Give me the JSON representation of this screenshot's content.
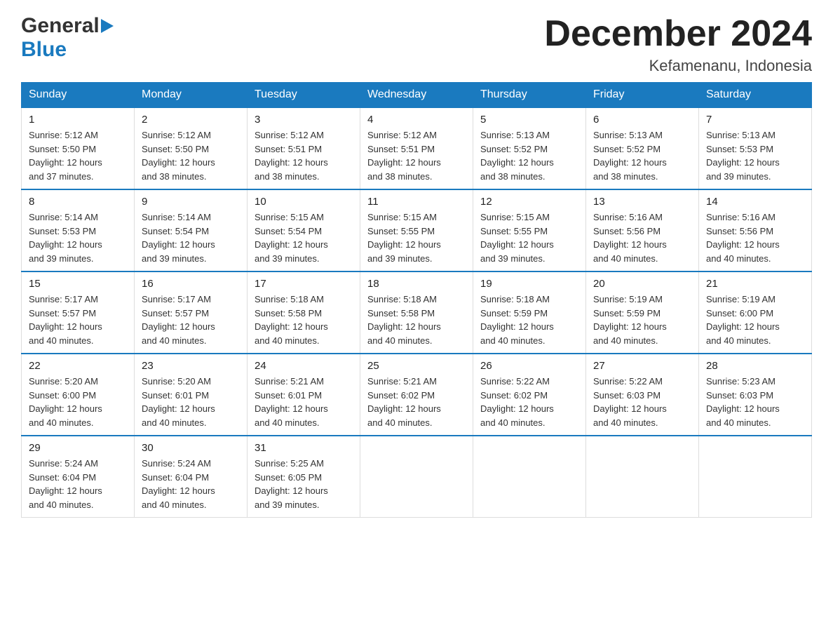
{
  "header": {
    "logo_general": "General",
    "logo_blue": "Blue",
    "month_title": "December 2024",
    "location": "Kefamenanu, Indonesia"
  },
  "days_of_week": [
    "Sunday",
    "Monday",
    "Tuesday",
    "Wednesday",
    "Thursday",
    "Friday",
    "Saturday"
  ],
  "weeks": [
    [
      {
        "day": "1",
        "sunrise": "5:12 AM",
        "sunset": "5:50 PM",
        "daylight": "12 hours and 37 minutes."
      },
      {
        "day": "2",
        "sunrise": "5:12 AM",
        "sunset": "5:50 PM",
        "daylight": "12 hours and 38 minutes."
      },
      {
        "day": "3",
        "sunrise": "5:12 AM",
        "sunset": "5:51 PM",
        "daylight": "12 hours and 38 minutes."
      },
      {
        "day": "4",
        "sunrise": "5:12 AM",
        "sunset": "5:51 PM",
        "daylight": "12 hours and 38 minutes."
      },
      {
        "day": "5",
        "sunrise": "5:13 AM",
        "sunset": "5:52 PM",
        "daylight": "12 hours and 38 minutes."
      },
      {
        "day": "6",
        "sunrise": "5:13 AM",
        "sunset": "5:52 PM",
        "daylight": "12 hours and 38 minutes."
      },
      {
        "day": "7",
        "sunrise": "5:13 AM",
        "sunset": "5:53 PM",
        "daylight": "12 hours and 39 minutes."
      }
    ],
    [
      {
        "day": "8",
        "sunrise": "5:14 AM",
        "sunset": "5:53 PM",
        "daylight": "12 hours and 39 minutes."
      },
      {
        "day": "9",
        "sunrise": "5:14 AM",
        "sunset": "5:54 PM",
        "daylight": "12 hours and 39 minutes."
      },
      {
        "day": "10",
        "sunrise": "5:15 AM",
        "sunset": "5:54 PM",
        "daylight": "12 hours and 39 minutes."
      },
      {
        "day": "11",
        "sunrise": "5:15 AM",
        "sunset": "5:55 PM",
        "daylight": "12 hours and 39 minutes."
      },
      {
        "day": "12",
        "sunrise": "5:15 AM",
        "sunset": "5:55 PM",
        "daylight": "12 hours and 39 minutes."
      },
      {
        "day": "13",
        "sunrise": "5:16 AM",
        "sunset": "5:56 PM",
        "daylight": "12 hours and 40 minutes."
      },
      {
        "day": "14",
        "sunrise": "5:16 AM",
        "sunset": "5:56 PM",
        "daylight": "12 hours and 40 minutes."
      }
    ],
    [
      {
        "day": "15",
        "sunrise": "5:17 AM",
        "sunset": "5:57 PM",
        "daylight": "12 hours and 40 minutes."
      },
      {
        "day": "16",
        "sunrise": "5:17 AM",
        "sunset": "5:57 PM",
        "daylight": "12 hours and 40 minutes."
      },
      {
        "day": "17",
        "sunrise": "5:18 AM",
        "sunset": "5:58 PM",
        "daylight": "12 hours and 40 minutes."
      },
      {
        "day": "18",
        "sunrise": "5:18 AM",
        "sunset": "5:58 PM",
        "daylight": "12 hours and 40 minutes."
      },
      {
        "day": "19",
        "sunrise": "5:18 AM",
        "sunset": "5:59 PM",
        "daylight": "12 hours and 40 minutes."
      },
      {
        "day": "20",
        "sunrise": "5:19 AM",
        "sunset": "5:59 PM",
        "daylight": "12 hours and 40 minutes."
      },
      {
        "day": "21",
        "sunrise": "5:19 AM",
        "sunset": "6:00 PM",
        "daylight": "12 hours and 40 minutes."
      }
    ],
    [
      {
        "day": "22",
        "sunrise": "5:20 AM",
        "sunset": "6:00 PM",
        "daylight": "12 hours and 40 minutes."
      },
      {
        "day": "23",
        "sunrise": "5:20 AM",
        "sunset": "6:01 PM",
        "daylight": "12 hours and 40 minutes."
      },
      {
        "day": "24",
        "sunrise": "5:21 AM",
        "sunset": "6:01 PM",
        "daylight": "12 hours and 40 minutes."
      },
      {
        "day": "25",
        "sunrise": "5:21 AM",
        "sunset": "6:02 PM",
        "daylight": "12 hours and 40 minutes."
      },
      {
        "day": "26",
        "sunrise": "5:22 AM",
        "sunset": "6:02 PM",
        "daylight": "12 hours and 40 minutes."
      },
      {
        "day": "27",
        "sunrise": "5:22 AM",
        "sunset": "6:03 PM",
        "daylight": "12 hours and 40 minutes."
      },
      {
        "day": "28",
        "sunrise": "5:23 AM",
        "sunset": "6:03 PM",
        "daylight": "12 hours and 40 minutes."
      }
    ],
    [
      {
        "day": "29",
        "sunrise": "5:24 AM",
        "sunset": "6:04 PM",
        "daylight": "12 hours and 40 minutes."
      },
      {
        "day": "30",
        "sunrise": "5:24 AM",
        "sunset": "6:04 PM",
        "daylight": "12 hours and 40 minutes."
      },
      {
        "day": "31",
        "sunrise": "5:25 AM",
        "sunset": "6:05 PM",
        "daylight": "12 hours and 39 minutes."
      },
      null,
      null,
      null,
      null
    ]
  ],
  "labels": {
    "sunrise": "Sunrise:",
    "sunset": "Sunset:",
    "daylight": "Daylight:"
  }
}
